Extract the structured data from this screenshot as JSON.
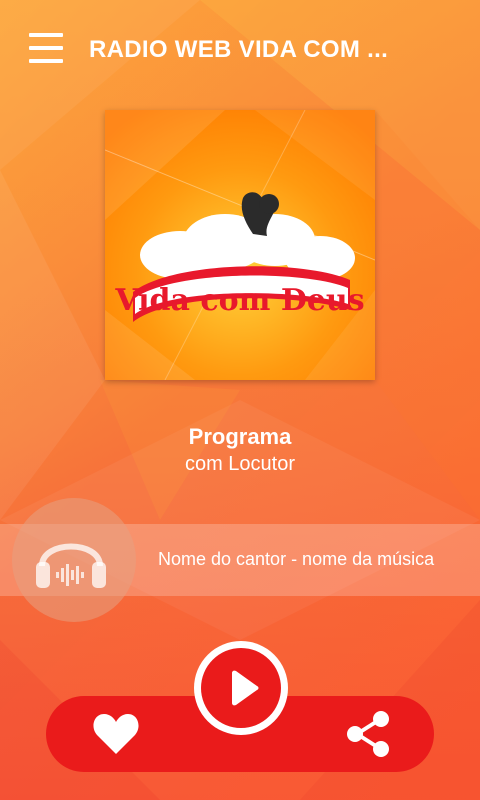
{
  "header": {
    "title": "RADIO WEB VIDA COM ...",
    "menu_icon": "hamburger-menu-icon"
  },
  "cover": {
    "logo_text": "Vida com Deus",
    "colors": {
      "accent": "#ff8a00",
      "banner": "#e8192c"
    }
  },
  "program": {
    "title": "Programa",
    "host": "com Locutor"
  },
  "now_playing": {
    "track": "Nome do cantor - nome da música",
    "icon": "headphones-icon"
  },
  "controls": {
    "like_icon": "heart-icon",
    "play_icon": "play-icon",
    "share_icon": "share-icon",
    "bar_color": "#ea1b1b"
  }
}
